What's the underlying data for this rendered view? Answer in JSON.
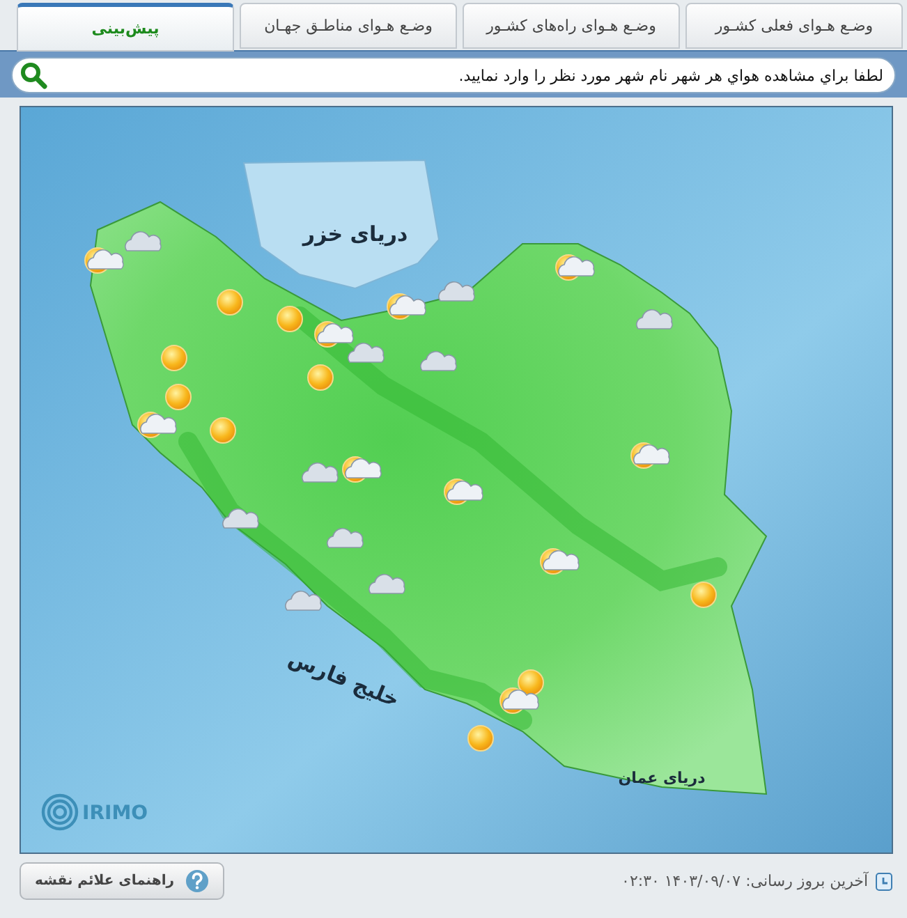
{
  "tabs": [
    {
      "label": "وضـع هـوای فعلی کشـور",
      "selected": false
    },
    {
      "label": "وضـع هـوای راه‌های کشـور",
      "selected": false
    },
    {
      "label": "وضـع هـوای مناطـق جهـان",
      "selected": false
    },
    {
      "label": "پیش‌بینی",
      "selected": true
    }
  ],
  "search": {
    "placeholder": "لطفا براي مشاهده هواي هر شهر نام شهر مورد نظر را وارد نماييد."
  },
  "map": {
    "labels": [
      {
        "kind": "caspian",
        "text": "دریای خزر"
      },
      {
        "kind": "gulf",
        "text": "خلیج فارس"
      },
      {
        "kind": "oman",
        "text": "دریای عمان"
      }
    ],
    "logo": "IRIMO"
  },
  "footer": {
    "legend_button": "راهنمای علائم نقشه",
    "last_update": "آخرین بروز رسانی: ۱۴۰۳/۰۹/۰۷ ۰۲:۳۰"
  }
}
